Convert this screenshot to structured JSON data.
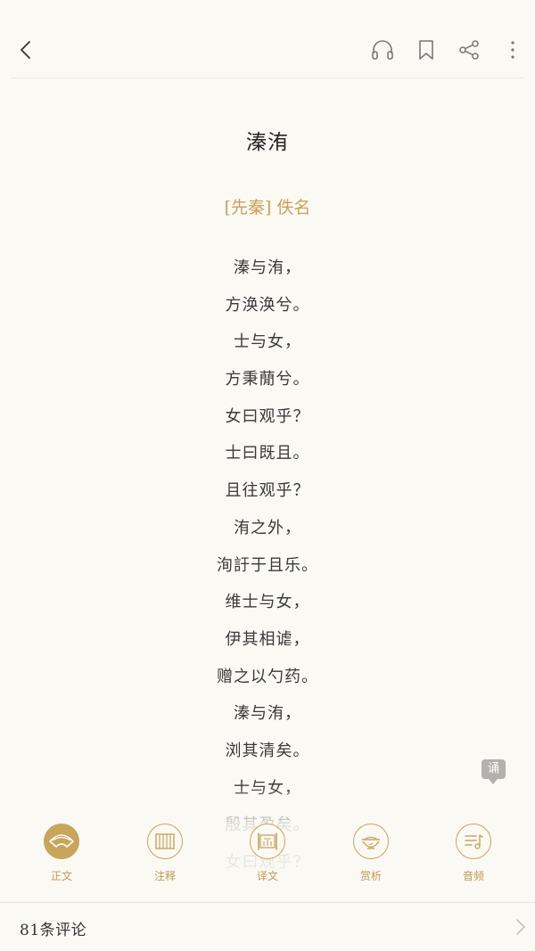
{
  "header": {
    "icons": [
      "back-icon",
      "headphones-icon",
      "bookmark-icon",
      "share-icon",
      "more-icon"
    ]
  },
  "poem": {
    "title": "溱洧",
    "author": "[先秦] 佚名",
    "lines": [
      "溱与洧，",
      "方涣涣兮。",
      "士与女，",
      "方秉蕑兮。",
      "女曰观乎？",
      "士曰既且。",
      "且往观乎？",
      "洧之外，",
      "洵訏于且乐。",
      "维士与女，",
      "伊其相谑，",
      "赠之以勺药。",
      "溱与洧，",
      "浏其清矣。",
      "士与女，",
      "殷其盈矣。",
      "女曰观乎？"
    ]
  },
  "recite_badge": "诵",
  "tabs": [
    {
      "label": "正文",
      "icon": "fan-icon",
      "active": true
    },
    {
      "label": "注释",
      "icon": "bamboo-slip-icon",
      "active": false
    },
    {
      "label": "译文",
      "icon": "scroll-icon",
      "active": false
    },
    {
      "label": "赏析",
      "icon": "tea-bowl-icon",
      "active": false
    },
    {
      "label": "音频",
      "icon": "audio-list-icon",
      "active": false
    }
  ],
  "colors": {
    "accent": "#c9a45b",
    "background": "#fbf9f4",
    "text": "#333333"
  },
  "comments": {
    "label": "81条评论"
  }
}
